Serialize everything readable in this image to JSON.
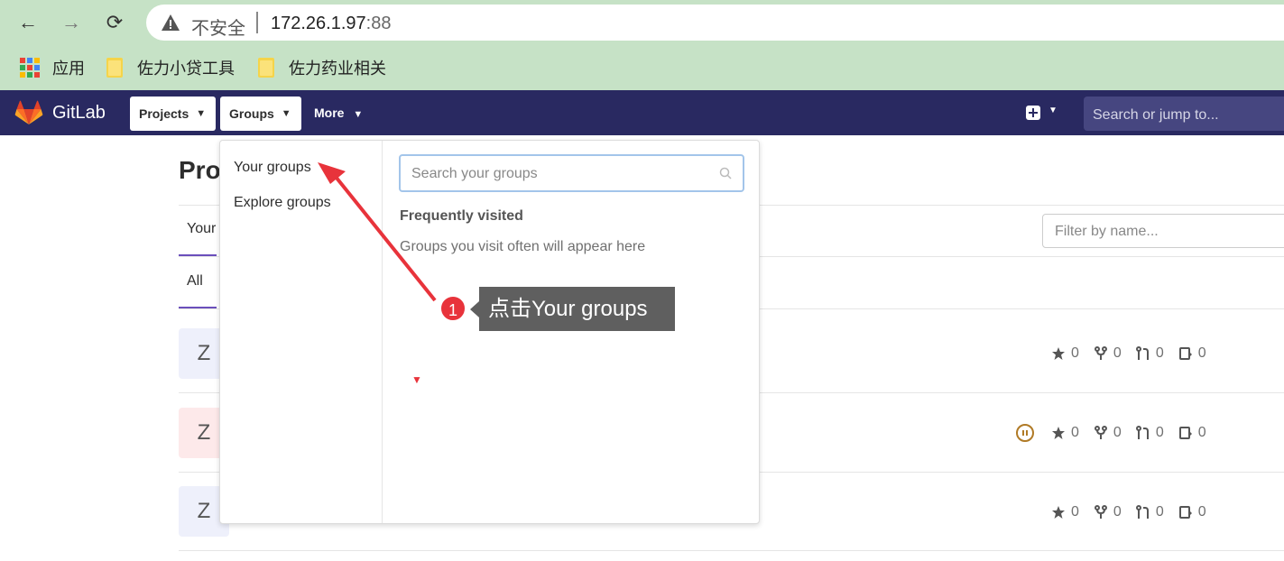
{
  "browser": {
    "back_icon": "←",
    "forward_icon": "→",
    "reload_icon": "⟳",
    "insecure_label": "不安全",
    "host": "172.26.1.97",
    "port": ":88",
    "bookmarks": [
      {
        "label": "应用",
        "icon": "apps-grid-icon"
      },
      {
        "label": "佐力小贷工具",
        "icon": "folder-icon"
      },
      {
        "label": "佐力药业相关",
        "icon": "folder-icon"
      }
    ]
  },
  "gitlab_header": {
    "brand": "GitLab",
    "projects_label": "Projects",
    "groups_label": "Groups",
    "more_label": "More",
    "search_placeholder": "Search or jump to..."
  },
  "page": {
    "title": "Proj",
    "tab_your": "Your",
    "tab_all": "All",
    "filter_placeholder": "Filter by name...",
    "rows": [
      {
        "avatar": "Z",
        "avatar_bg": "#eef0fb",
        "stars": "0",
        "forks": "0",
        "merge_requests": "0",
        "issues": "0",
        "paused": false
      },
      {
        "avatar": "Z",
        "avatar_bg": "#fde9ea",
        "stars": "0",
        "forks": "0",
        "merge_requests": "0",
        "issues": "0",
        "paused": true
      },
      {
        "avatar": "Z",
        "avatar_bg": "#eef0fb",
        "stars": "0",
        "forks": "0",
        "merge_requests": "0",
        "issues": "0",
        "paused": false
      }
    ]
  },
  "groups_dropdown": {
    "your_groups": "Your groups",
    "explore_groups": "Explore groups",
    "search_placeholder": "Search your groups",
    "frequently_visited_title": "Frequently visited",
    "frequently_visited_empty": "Groups you visit often will appear here"
  },
  "annotation": {
    "step_number": "1",
    "text": "点击Your groups",
    "color": "#e8333b"
  },
  "colors": {
    "browser_bg": "#c6e2c6",
    "header_bg": "#292961",
    "accent": "#6b4fbb"
  }
}
